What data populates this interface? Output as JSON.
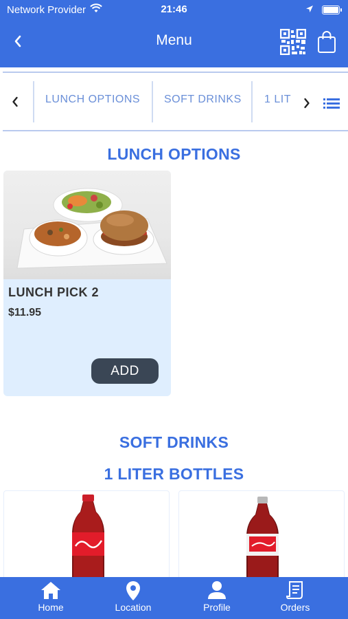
{
  "status_bar": {
    "carrier": "Network Provider",
    "time": "21:46"
  },
  "header": {
    "title": "Menu",
    "icons": {
      "back": "chevron-left-icon",
      "qr": "qr-code-icon",
      "bag": "shopping-bag-icon"
    }
  },
  "tabs": {
    "items": [
      {
        "label": "LUNCH OPTIONS"
      },
      {
        "label": "SOFT DRINKS"
      },
      {
        "label": "1 LIT"
      }
    ]
  },
  "sections": {
    "lunch_title": "LUNCH OPTIONS",
    "soft_drinks_title": "SOFT DRINKS",
    "bottles_title": "1 LITER BOTTLES"
  },
  "product": {
    "name": "LUNCH PICK 2",
    "price": "$11.95",
    "add_label": "ADD"
  },
  "drinks": [
    {
      "brand": "Coca-Cola"
    },
    {
      "brand": "Coke"
    }
  ],
  "bottom_nav": {
    "items": [
      {
        "label": "Home",
        "icon": "home-icon"
      },
      {
        "label": "Location",
        "icon": "location-pin-icon"
      },
      {
        "label": "Profile",
        "icon": "profile-icon"
      },
      {
        "label": "Orders",
        "icon": "orders-receipt-icon"
      }
    ]
  },
  "colors": {
    "primary": "#3a6fe0",
    "card_bg": "#dfeefe",
    "button_dark": "#3a4655",
    "tab_text": "#6a8fd8"
  }
}
